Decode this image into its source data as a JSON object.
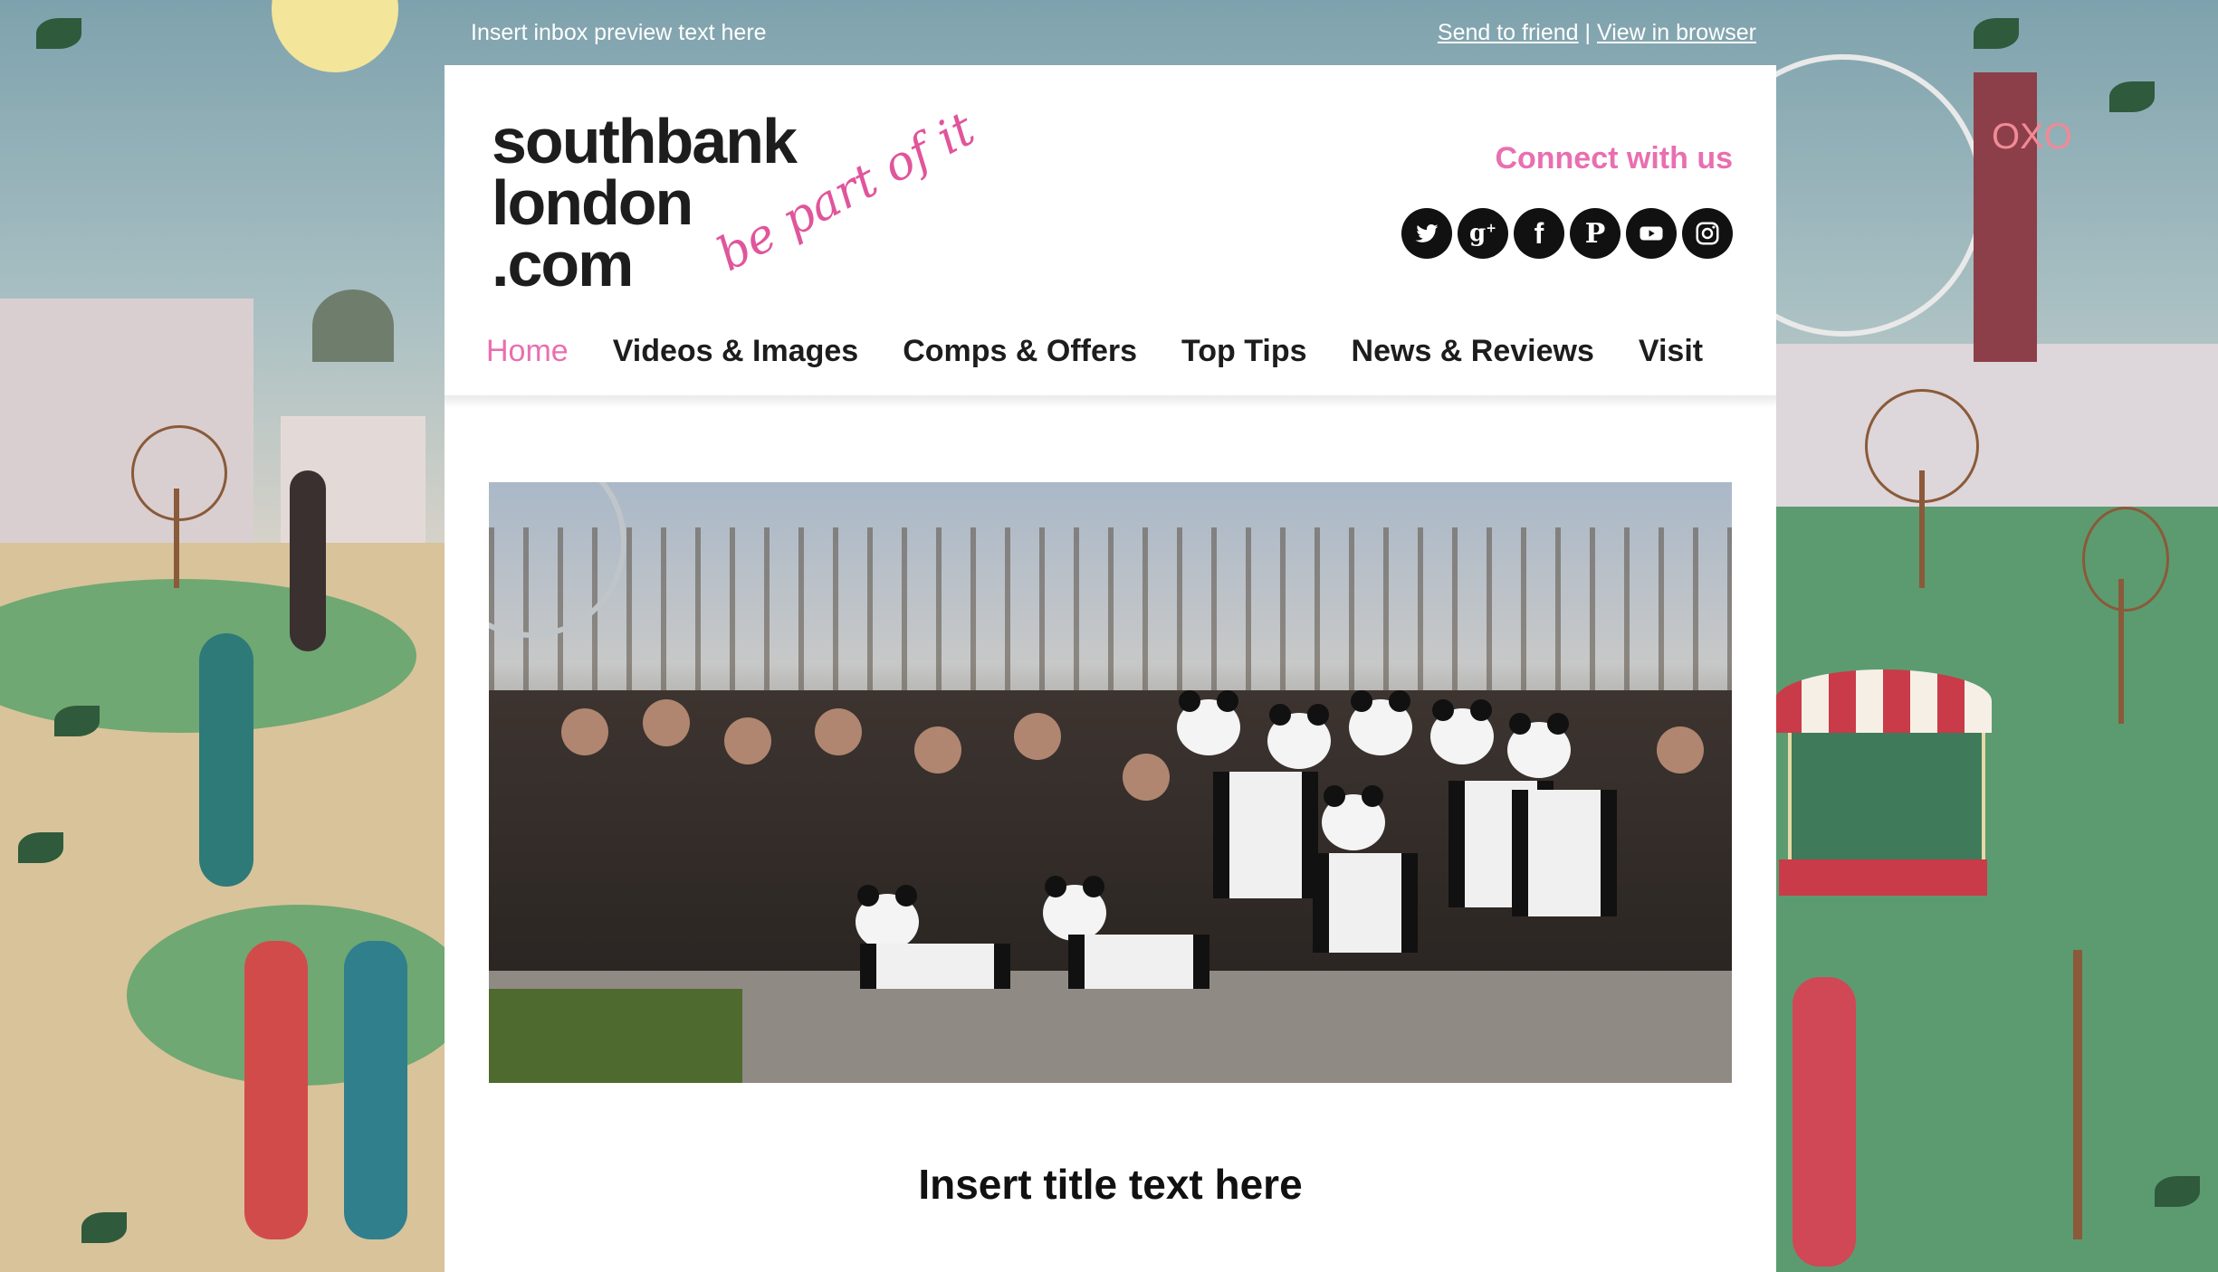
{
  "preheader": {
    "preview_text": "Insert inbox preview text here",
    "send_to_friend": "Send to friend",
    "separator": "|",
    "view_in_browser": "View in browser"
  },
  "header": {
    "logo_lines": [
      "southbank",
      "london",
      ".com"
    ],
    "tagline": "be part of it",
    "connect_label": "Connect with us",
    "social_icons": [
      "twitter-icon",
      "google-plus-icon",
      "facebook-icon",
      "pinterest-icon",
      "youtube-icon",
      "instagram-icon"
    ]
  },
  "nav": {
    "items": [
      "Home",
      "Videos & Images",
      "Comps & Offers",
      "Top Tips",
      "News & Reviews",
      "Visit"
    ],
    "active": "Home"
  },
  "background_sign": "OXO",
  "main": {
    "hero_alt": "Group photo of people and panda costumes on the South Bank",
    "title": "Insert title text here"
  },
  "colors": {
    "accent_pink": "#e96fb0",
    "logo_text": "#1d1d1d",
    "background": "#8fb0b9"
  }
}
